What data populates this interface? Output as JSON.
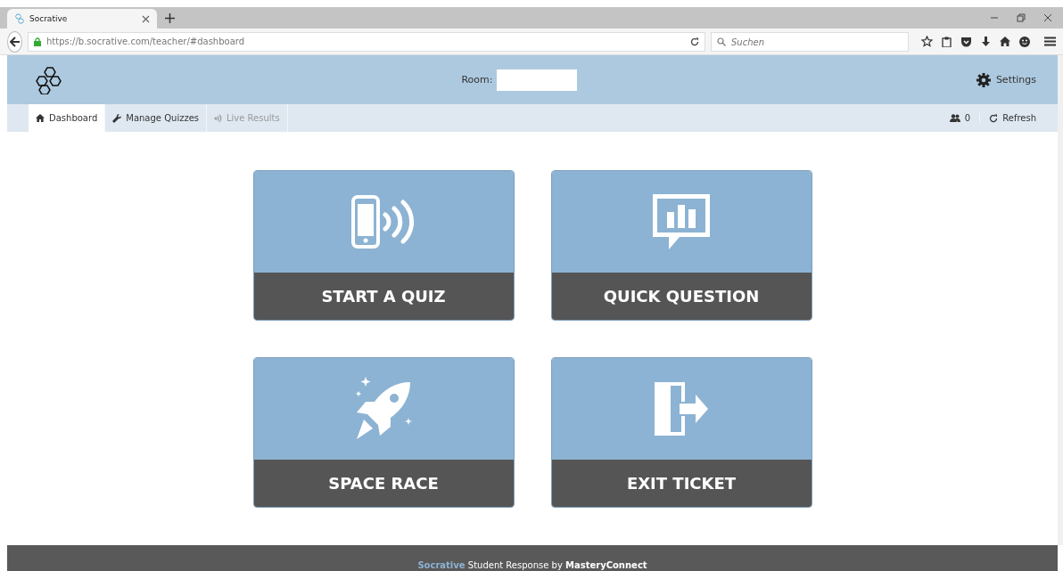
{
  "browser": {
    "tab": {
      "title": "Socrative",
      "selected": true
    },
    "url": "https://b.socrative.com/teacher/#dashboard",
    "search": {
      "placeholder": "Suchen"
    }
  },
  "header": {
    "room_label": "Room:",
    "settings": "Settings"
  },
  "nav": {
    "items": [
      {
        "label": "Dashboard",
        "kind": "home",
        "selected": true,
        "disabled": false
      },
      {
        "label": "Manage Quizzes",
        "kind": "wrench",
        "selected": false,
        "disabled": false
      },
      {
        "label": "Live Results",
        "kind": "signal",
        "selected": false,
        "disabled": true
      }
    ],
    "student_count": "0",
    "refresh": "Refresh"
  },
  "tiles": [
    {
      "label": "START A QUIZ",
      "kind": "phone"
    },
    {
      "label": "QUICK QUESTION",
      "kind": "chart"
    },
    {
      "label": "SPACE RACE",
      "kind": "rocket"
    },
    {
      "label": "EXIT TICKET",
      "kind": "exit"
    }
  ],
  "footer": {
    "brand": "Socrative",
    "text": " Student Response by **MasteryConnect**"
  }
}
